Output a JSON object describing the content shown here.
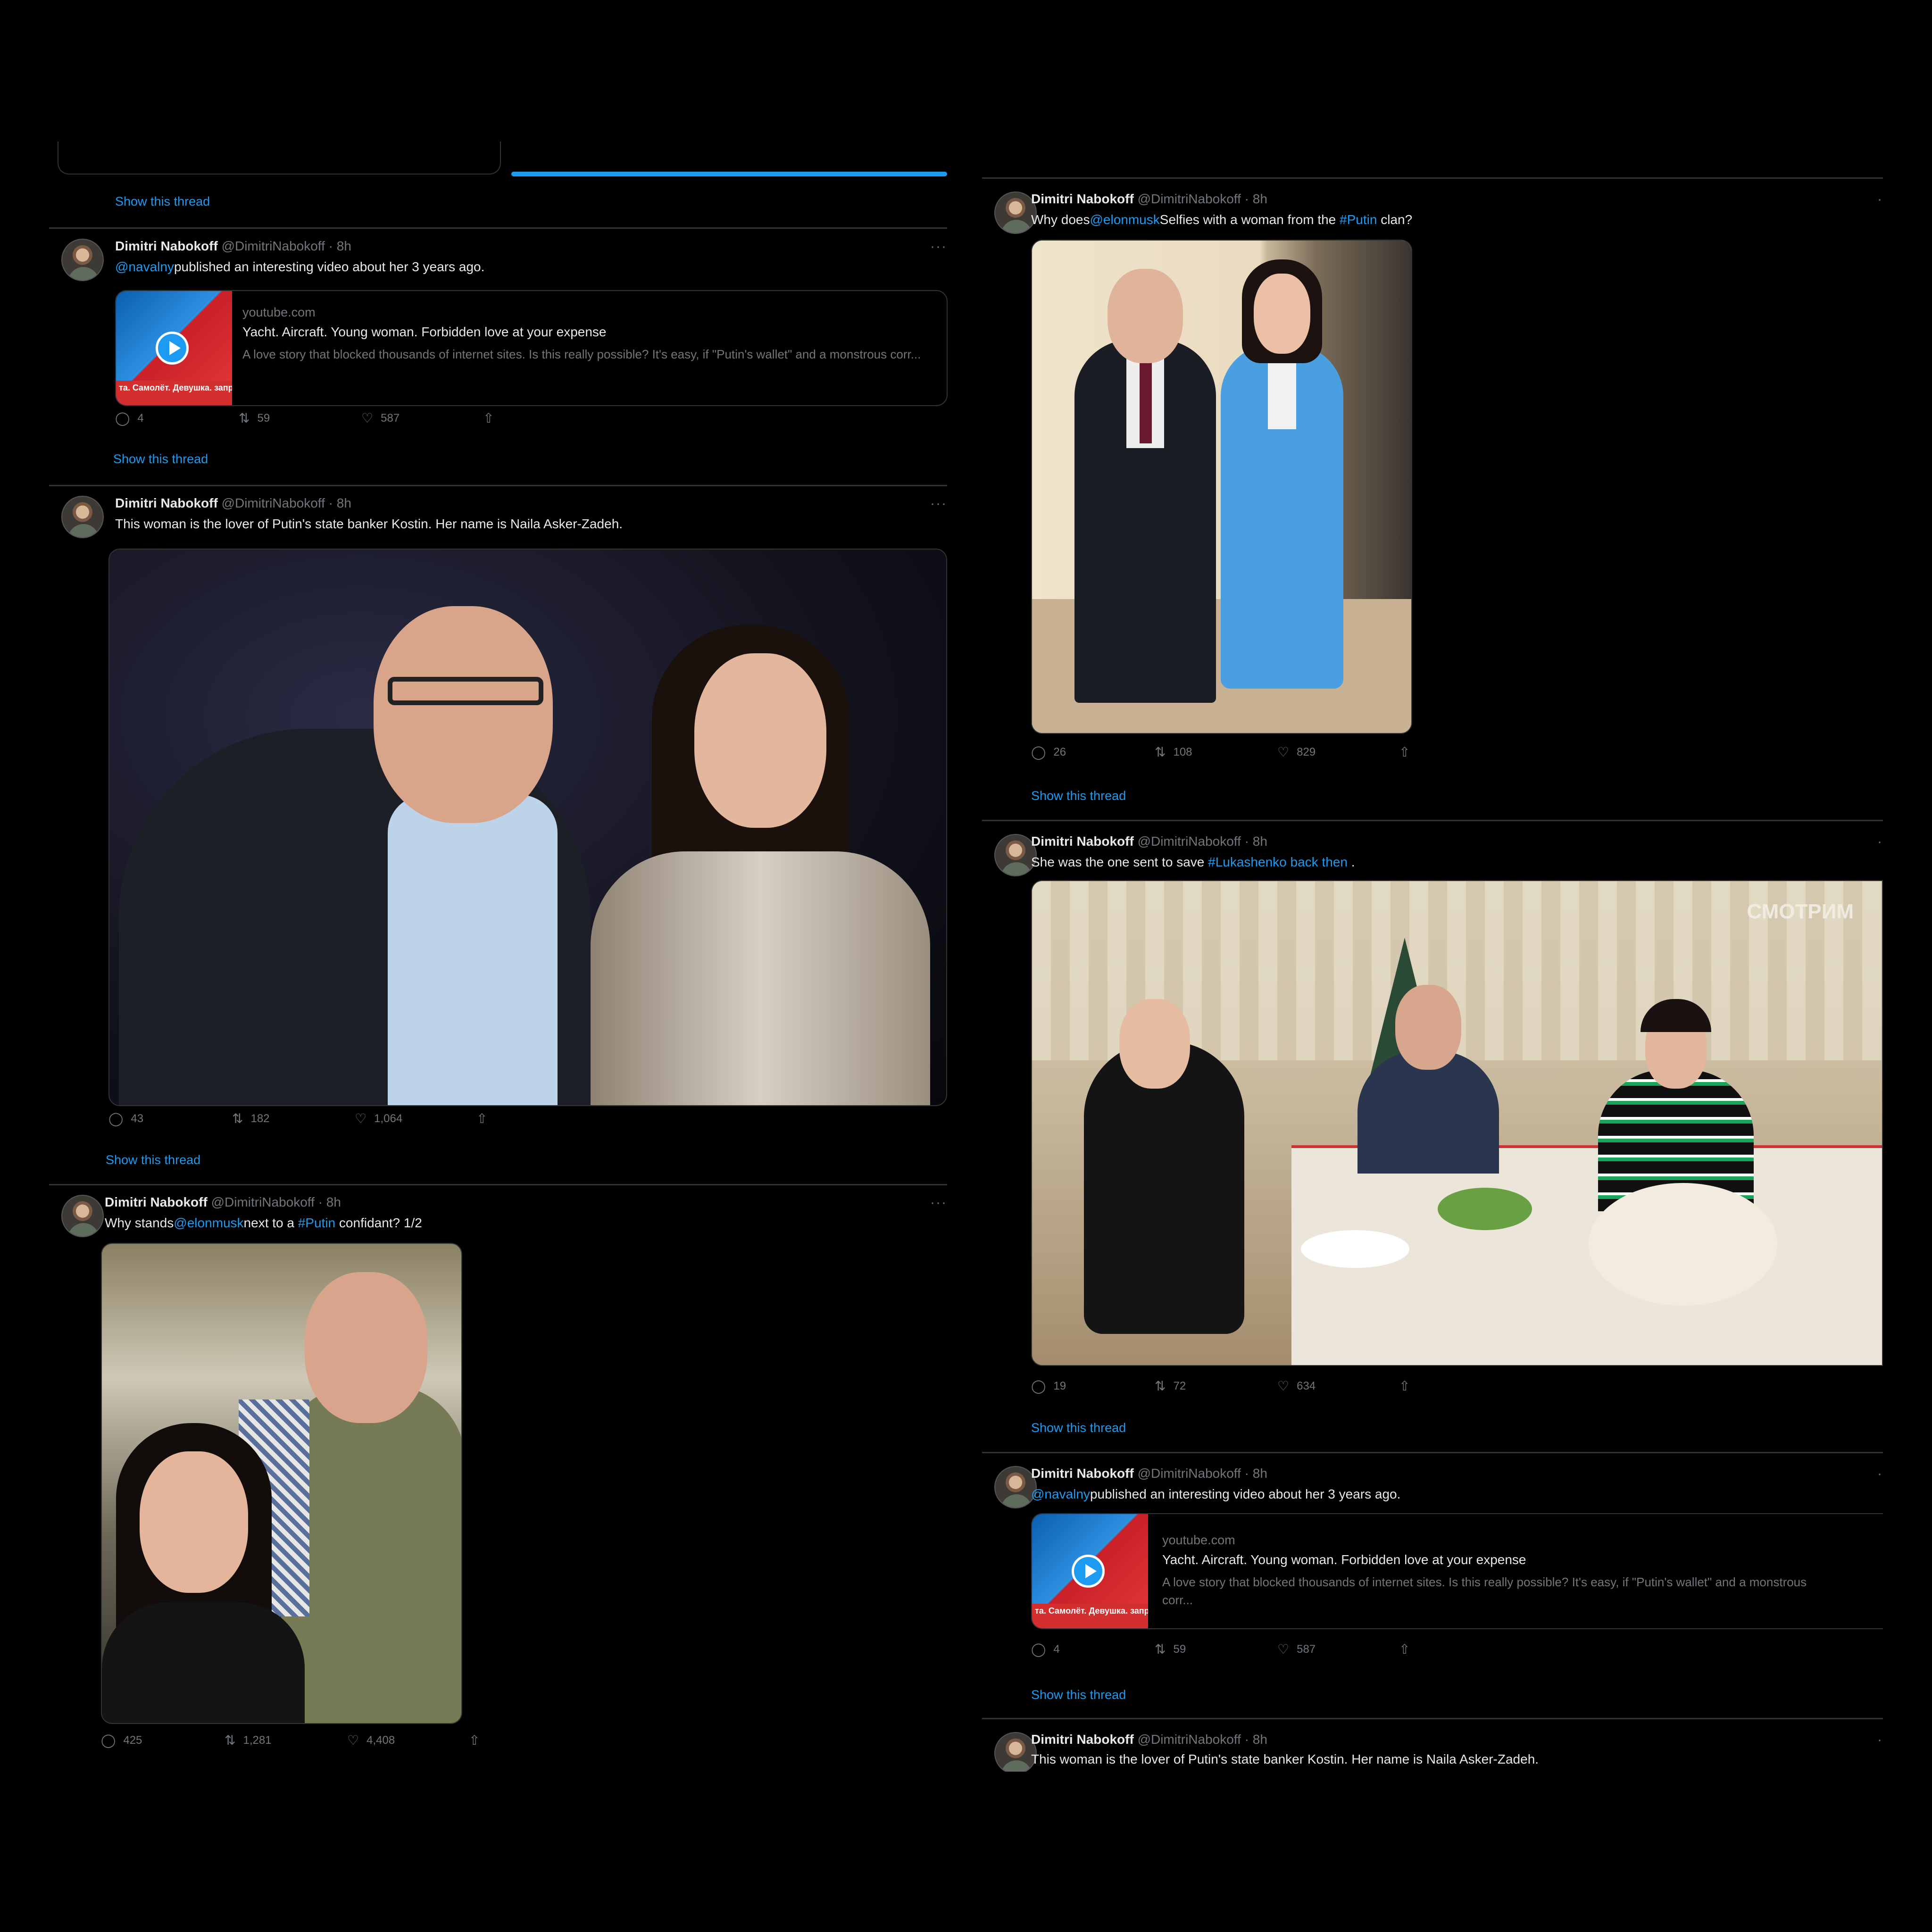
{
  "common": {
    "author_name": "Dimitri Nabokoff",
    "author_meta": "@DimitriNabokoff · 8h",
    "show_thread": "Show this thread",
    "more": "···"
  },
  "left": {
    "show_thread_top": "Show this thread",
    "tweets": [
      {
        "text_mention": "@navalny",
        "text_rest": "published an interesting video about her 3 years ago.",
        "card": {
          "domain": "youtube.com",
          "title": "Yacht. Aircraft. Young woman. Forbidden love at your expense",
          "desc": "A love story that blocked thousands of internet sites. Is this really possible? It's easy, if \"Putin's wallet\" and a monstrous corr...",
          "thumb_text": "та. Самолёт. Девушка. запретная любовь за ваш с"
        },
        "stats": {
          "replies": "4",
          "retweets": "59",
          "likes": "587"
        }
      },
      {
        "text": "This woman is the lover of Putin's state banker Kostin. Her name is Naila Asker-Zadeh.",
        "stats": {
          "replies": "43",
          "retweets": "182",
          "likes": "1,064"
        }
      },
      {
        "text_a": "Why stands",
        "mention": "@elonmusk",
        "text_b": "next to a ",
        "hashtag": "#Putin",
        "text_c": " confidant? 1/2",
        "stats": {
          "replies": "425",
          "retweets": "1,281",
          "likes": "4,408"
        }
      }
    ]
  },
  "right": {
    "tweets": [
      {
        "text_a": "Why does",
        "mention": "@elonmusk",
        "text_b": "Selfies with a woman from the ",
        "hashtag": "#Putin",
        "text_c": " clan?",
        "stats": {
          "replies": "26",
          "retweets": "108",
          "likes": "829"
        }
      },
      {
        "text_a": "She was the one sent to save ",
        "hashtag": "#Lukashenko back then",
        "text_c": " .",
        "watermark": "СМОТРИМ",
        "stats": {
          "replies": "19",
          "retweets": "72",
          "likes": "634"
        }
      },
      {
        "text_mention": "@navalny",
        "text_rest": "published an interesting video about her 3 years ago.",
        "card": {
          "domain": "youtube.com",
          "title": "Yacht. Aircraft. Young woman. Forbidden love at your expense",
          "desc": "A love story that blocked thousands of internet sites. Is this really possible? It's easy, if \"Putin's wallet\" and a monstrous corr...",
          "thumb_text": "та. Самолёт. Девушка. запретная любовь за ваш с"
        },
        "stats": {
          "replies": "4",
          "retweets": "59",
          "likes": "587"
        }
      },
      {
        "text": "This woman is the lover of Putin's state banker Kostin. Her name is Naila Asker-Zadeh."
      }
    ]
  },
  "icons": {
    "reply": "reply-icon",
    "retweet": "retweet-icon",
    "like": "heart-icon",
    "share": "share-icon",
    "play": "play-icon",
    "more": "more-icon"
  },
  "colors": {
    "background": "#000000",
    "link": "#1d9bf0",
    "secondary_text": "#71767b",
    "primary_text": "#e7e9ea"
  }
}
